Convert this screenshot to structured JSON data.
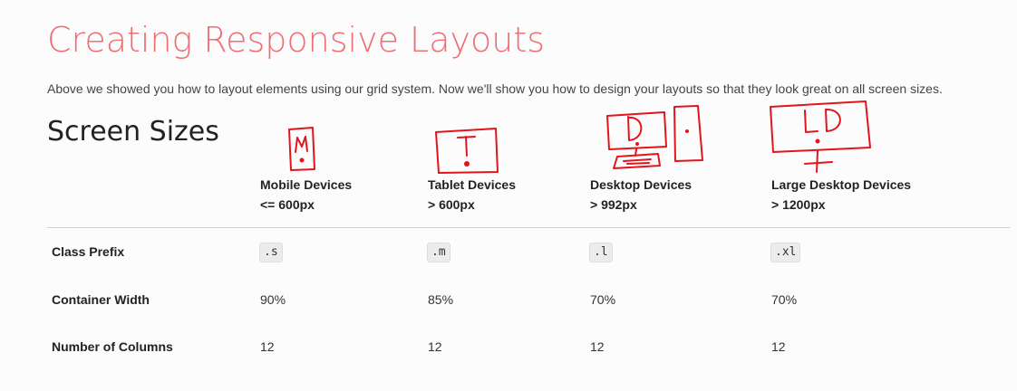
{
  "header": {
    "title": "Creating Responsive Layouts",
    "intro": "Above we showed you how to layout elements using our grid system. Now we'll show you how to design your layouts so that they look great on all screen sizes."
  },
  "section": {
    "title": "Screen Sizes"
  },
  "table": {
    "columns": [
      {
        "name": "Mobile Devices",
        "size": "<= 600px"
      },
      {
        "name": "Tablet Devices",
        "size": "> 600px"
      },
      {
        "name": "Desktop Devices",
        "size": "> 992px"
      },
      {
        "name": "Large Desktop Devices",
        "size": "> 1200px"
      }
    ],
    "rows": [
      {
        "label": "Class Prefix",
        "values": [
          ".s",
          ".m",
          ".l",
          ".xl"
        ]
      },
      {
        "label": "Container Width",
        "values": [
          "90%",
          "85%",
          "70%",
          "70%"
        ]
      },
      {
        "label": "Number of Columns",
        "values": [
          "12",
          "12",
          "12",
          "12"
        ]
      }
    ]
  },
  "sketches": {
    "mobile_letter": "M",
    "tablet_letter": "T",
    "desktop_letter": "D",
    "large_desktop_letters": "LD"
  },
  "colors": {
    "title": "#ee6e73",
    "sketch": "#e3151c"
  }
}
